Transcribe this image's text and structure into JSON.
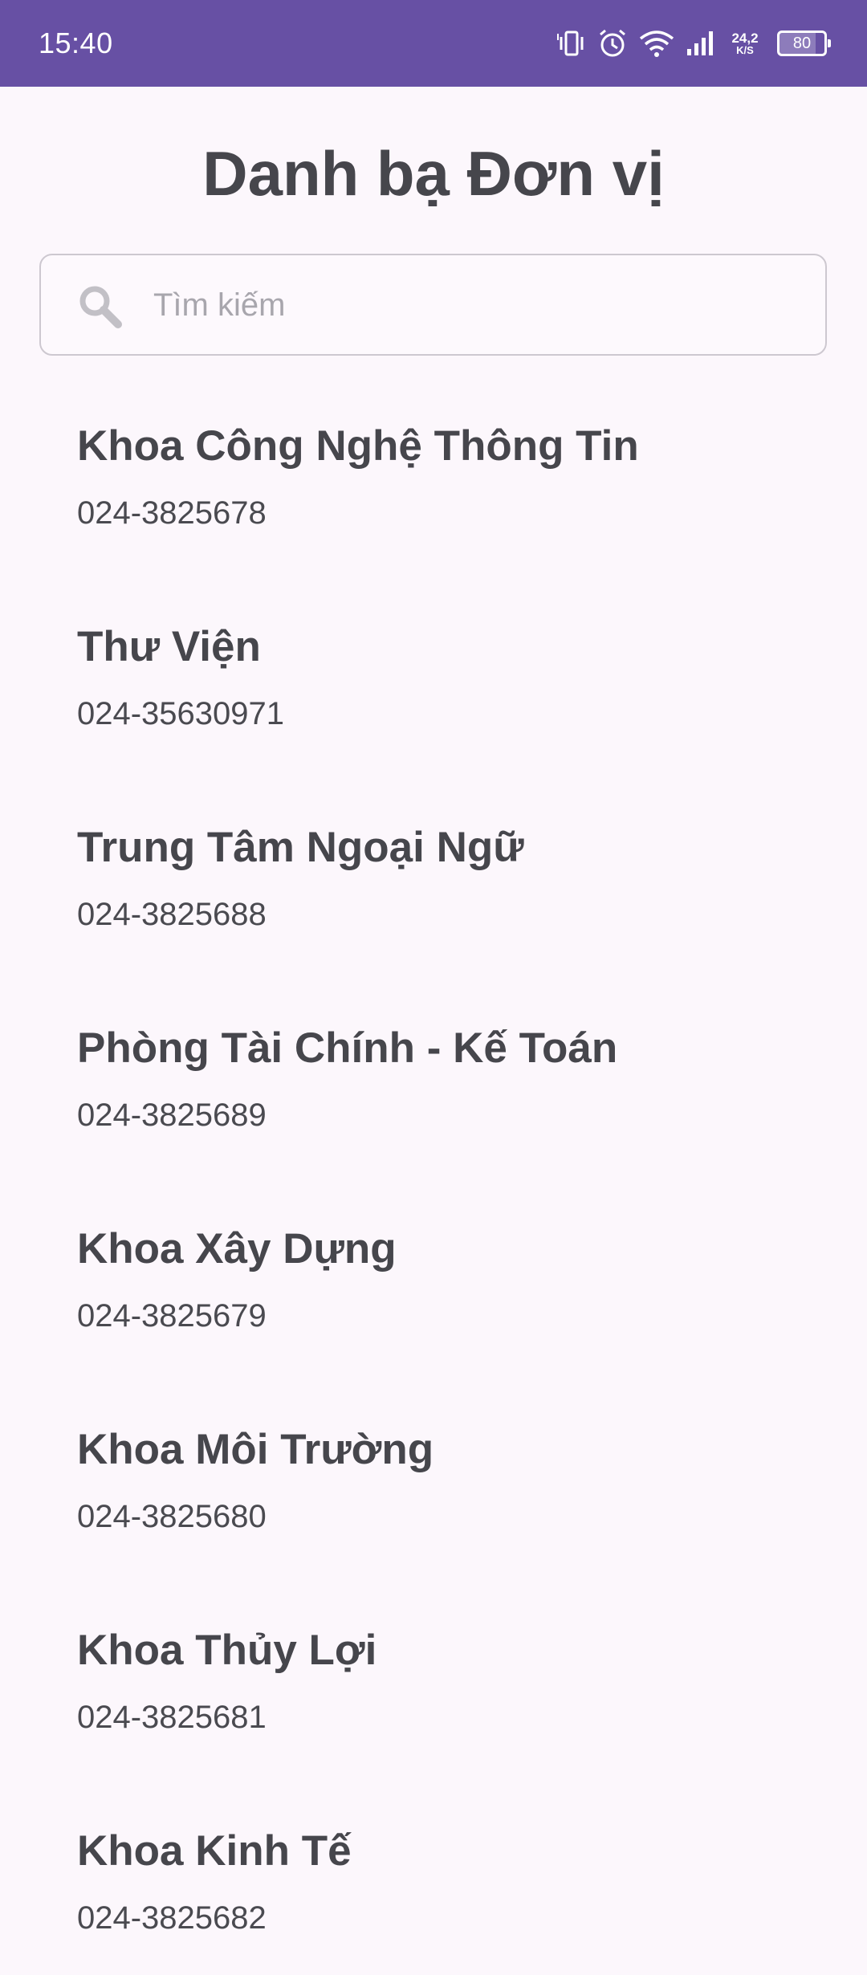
{
  "status_bar": {
    "time": "15:40",
    "net_speed_value": "24,2",
    "net_speed_unit": "K/S",
    "battery_level": "80",
    "background_color": "#6750a4",
    "icons": [
      "vibrate-icon",
      "alarm-icon",
      "wifi-icon",
      "signal-icon"
    ]
  },
  "page": {
    "title": "Danh bạ Đơn vị",
    "background_color": "#fcf7fc"
  },
  "search": {
    "placeholder": "Tìm kiếm",
    "value": "",
    "icon": "search-icon"
  },
  "contacts": [
    {
      "name": "Khoa Công Nghệ Thông Tin",
      "phone": "024-3825678"
    },
    {
      "name": "Thư Viện",
      "phone": "024-35630971"
    },
    {
      "name": "Trung Tâm Ngoại Ngữ",
      "phone": "024-3825688"
    },
    {
      "name": "Phòng Tài Chính - Kế Toán",
      "phone": "024-3825689"
    },
    {
      "name": "Khoa Xây Dựng",
      "phone": "024-3825679"
    },
    {
      "name": "Khoa Môi Trường",
      "phone": "024-3825680"
    },
    {
      "name": "Khoa Thủy Lợi",
      "phone": "024-3825681"
    },
    {
      "name": "Khoa Kinh Tế",
      "phone": "024-3825682"
    }
  ]
}
